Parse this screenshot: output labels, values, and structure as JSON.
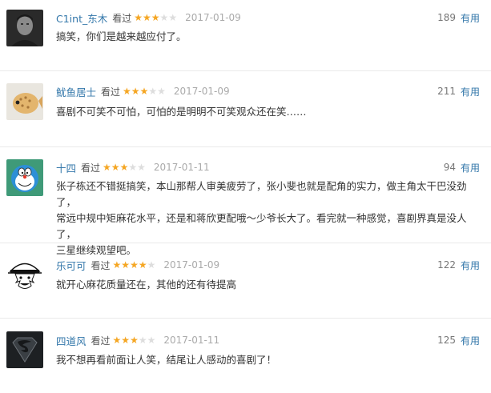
{
  "reviews": [
    {
      "user": "C1int_东木",
      "watched": "看过",
      "stars": 3,
      "date": "2017-01-09",
      "votes": "189",
      "useful": "有用",
      "avatar": "man-portrait-avatar",
      "content": "搞笑，你们是越来越应付了。"
    },
    {
      "user": "鱿鱼居士",
      "watched": "看过",
      "stars": 3,
      "date": "2017-01-09",
      "votes": "211",
      "useful": "有用",
      "avatar": "pufferfish-avatar",
      "content": "喜剧不可笑不可怕，可怕的是明明不可笑观众还在笑……"
    },
    {
      "user": "十四",
      "watched": "看过",
      "stars": 3,
      "date": "2017-01-11",
      "votes": "94",
      "useful": "有用",
      "avatar": "doraemon-avatar",
      "content_lines": [
        "张子栋还不错挺搞笑，本山那帮人审美疲劳了，张小斐也就是配角的实力，做主角太干巴没劲了，",
        "常远中规中矩麻花水平，还是和蒋欣更配哦～少爷长大了。看完就一种感觉，喜剧界真是没人了，",
        "三星继续观望吧。"
      ]
    },
    {
      "user": "乐可可",
      "watched": "看过",
      "stars": 4,
      "date": "2017-01-09",
      "votes": "122",
      "useful": "有用",
      "avatar": "luffy-sketch-avatar",
      "content": "就开心麻花质量还在，其他的还有待提高"
    },
    {
      "user": "四道风",
      "watched": "看过",
      "stars": 3,
      "date": "2017-01-11",
      "votes": "125",
      "useful": "有用",
      "avatar": "superman-logo-avatar",
      "content": "我不想再看前面让人笑，结尾让人感动的喜剧了！"
    }
  ],
  "colors": {
    "username": "#3377aa",
    "star_on": "#f5a623",
    "star_off": "#dddddd",
    "date": "#aaaaaa",
    "text": "#333333"
  }
}
